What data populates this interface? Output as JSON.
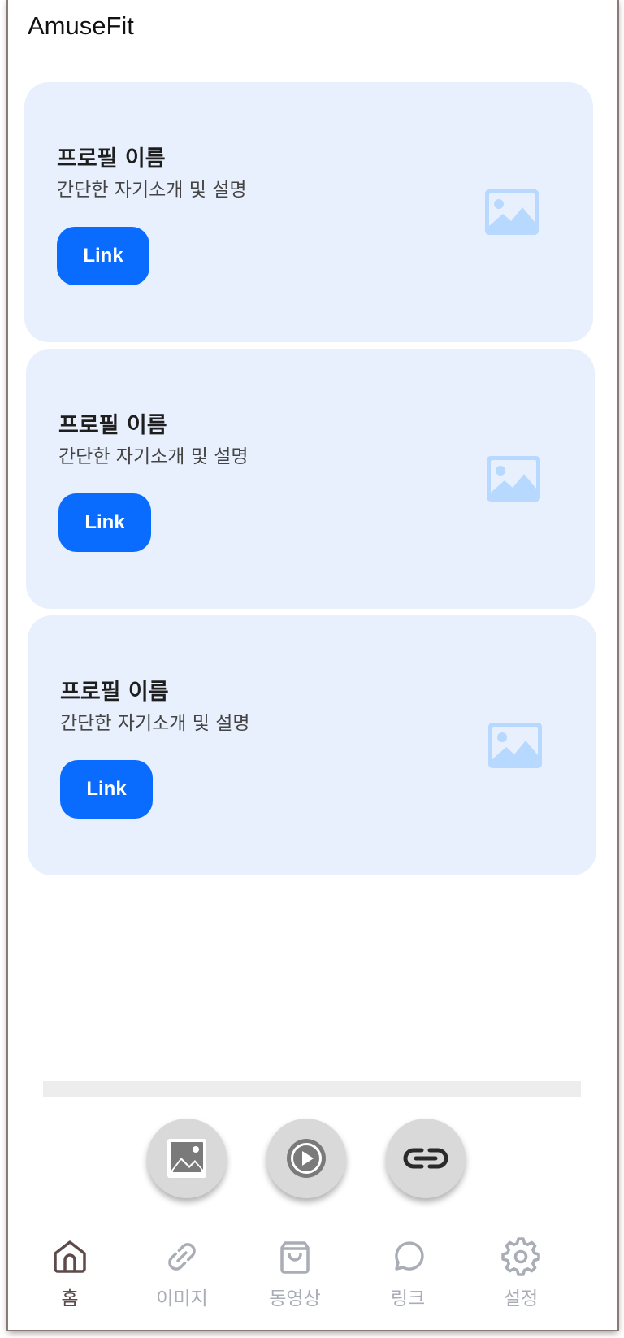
{
  "header": {
    "title": "AmuseFit"
  },
  "cards": [
    {
      "name": "프로필 이름",
      "description": "간단한 자기소개 및 설명",
      "button_label": "Link",
      "image_icon": "image-icon"
    },
    {
      "name": "프로필 이름",
      "description": "간단한 자기소개 및 설명",
      "button_label": "Link",
      "image_icon": "image-icon"
    },
    {
      "name": "프로필 이름",
      "description": "간단한 자기소개 및 설명",
      "button_label": "Link",
      "image_icon": "image-icon"
    }
  ],
  "fab_buttons": [
    {
      "icon": "image-icon"
    },
    {
      "icon": "play-icon"
    },
    {
      "icon": "link-icon"
    }
  ],
  "bottom_nav": [
    {
      "label": "홈",
      "icon": "home-icon",
      "active": true
    },
    {
      "label": "이미지",
      "icon": "link-icon",
      "active": false
    },
    {
      "label": "동영상",
      "icon": "shopping-bag-icon",
      "active": false
    },
    {
      "label": "링크",
      "icon": "chat-bubble-icon",
      "active": false
    },
    {
      "label": "설정",
      "icon": "gear-icon",
      "active": false
    }
  ],
  "colors": {
    "accent": "#0a6cff",
    "card_background": "#e8f0fd",
    "placeholder_icon": "#b7d8ff",
    "nav_inactive": "#a9adb5",
    "nav_active": "#5e4a4a",
    "fab_background": "#d9d9d9"
  }
}
